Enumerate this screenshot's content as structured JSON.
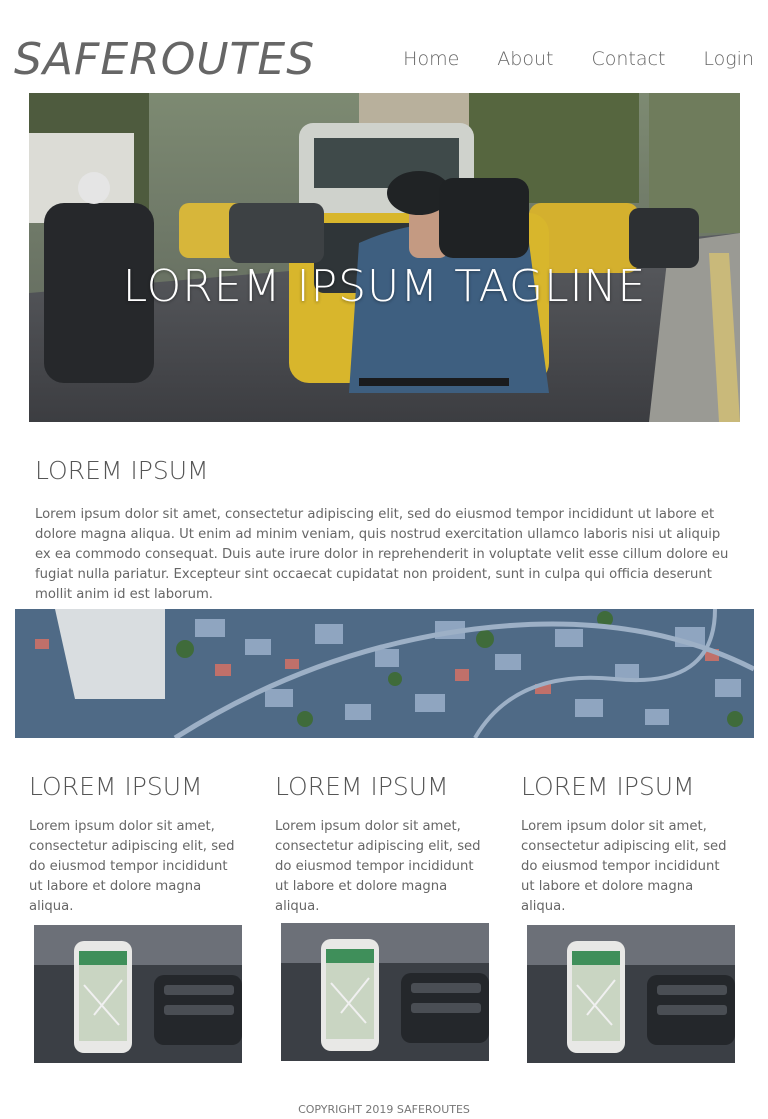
{
  "header": {
    "logo": "SAFEROUTES",
    "nav": [
      "Home",
      "About",
      "Contact",
      "Login"
    ]
  },
  "hero": {
    "tagline": "LOREM IPSUM TAGLINE"
  },
  "intro": {
    "heading": "LOREM IPSUM",
    "body": "Lorem ipsum dolor sit amet, consectetur adipiscing elit, sed do eiusmod tempor incididunt ut labore et dolore magna aliqua. Ut enim ad minim veniam, quis nostrud exercitation ullamco laboris nisi ut aliquip ex ea commodo consequat. Duis aute irure dolor in reprehenderit in voluptate velit esse cillum dolore eu fugiat nulla pariatur. Excepteur sint occaecat cupidatat non proident, sunt in culpa qui officia deserunt mollit anim id est laborum."
  },
  "columns": [
    {
      "heading": "LOREM IPSUM",
      "body": "Lorem ipsum dolor sit amet, consectetur adipiscing elit, sed do eiusmod tempor incididunt ut labore et dolore magna aliqua."
    },
    {
      "heading": "LOREM IPSUM",
      "body": "Lorem ipsum dolor sit amet, consectetur adipiscing elit, sed do eiusmod tempor incididunt ut labore et dolore magna aliqua."
    },
    {
      "heading": "LOREM IPSUM",
      "body": "Lorem ipsum dolor sit amet, consectetur adipiscing elit, sed do eiusmod tempor incididunt ut labore et dolore magna aliqua."
    }
  ],
  "footer": {
    "copyright": "COPYRIGHT 2019 SAFEROUTES"
  }
}
